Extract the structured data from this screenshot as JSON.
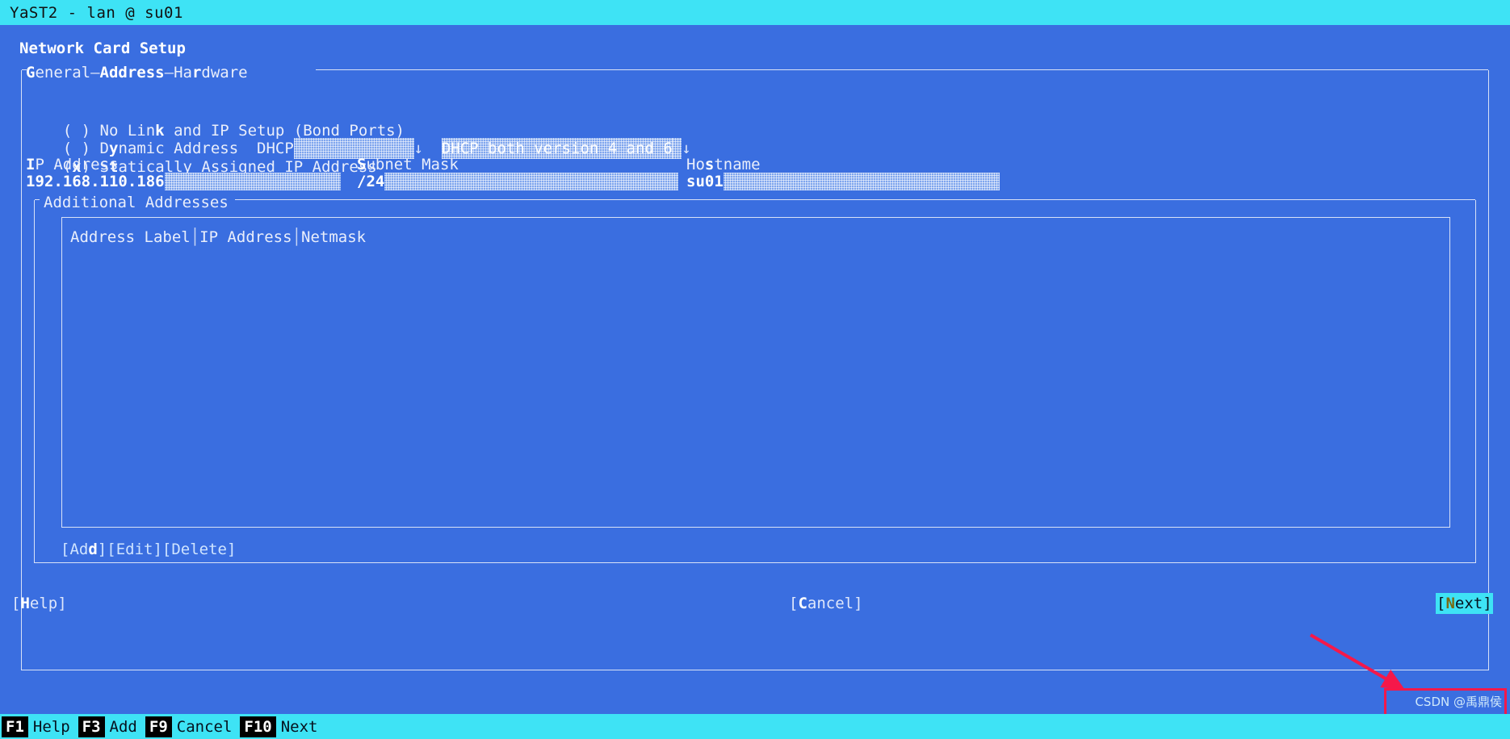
{
  "window": {
    "title": "YaST2 - lan @ su01"
  },
  "dialog": {
    "title": "Network Card Setup"
  },
  "tabs": [
    {
      "label": "General",
      "shortcut": "G",
      "active": false
    },
    {
      "label": "Address",
      "shortcut": "A",
      "active": true
    },
    {
      "label": "Hardware",
      "shortcut": "r",
      "active": false
    }
  ],
  "tab_separator": "—",
  "address_tab": {
    "radios": [
      {
        "marker": "( )",
        "label_pre": "No Lin",
        "shortcut": "k",
        "label_post": " and IP Setup (Bond Ports)",
        "selected": false
      },
      {
        "marker": "( )",
        "label_pre": "D",
        "shortcut": "y",
        "label_post": "namic Address",
        "selected": false
      },
      {
        "marker": "(x)",
        "label_pre": "S",
        "shortcut": "t",
        "label_post": "atically Assigned IP Address",
        "selected": true
      }
    ],
    "dhcp_combo": {
      "label": "DHCP",
      "value": "",
      "arrow": "↓"
    },
    "dhcp_version_combo": {
      "value": "DHCP both version 4 and 6",
      "arrow": "↓"
    },
    "fields": [
      {
        "name": "ip-address",
        "label_pre": "",
        "shortcut": "I",
        "label_post": "P Address",
        "value": "192.168.110.186"
      },
      {
        "name": "subnet-mask",
        "label_pre": "",
        "shortcut": "S",
        "label_post": "ubnet Mask",
        "value": "/24"
      },
      {
        "name": "hostname",
        "label_pre": "Ho",
        "shortcut": "s",
        "label_post": "tname",
        "value": "su01"
      }
    ],
    "additional_addresses": {
      "frame_label": "Additional Addresses",
      "columns": [
        "Address Label",
        "IP Address",
        "Netmask"
      ],
      "rows": [],
      "buttons": [
        {
          "label_pre": "Ad",
          "shortcut": "d",
          "label_post": ""
        },
        {
          "label_pre": "Edit",
          "shortcut": "",
          "label_post": ""
        },
        {
          "label_pre": "Delete",
          "shortcut": "",
          "label_post": ""
        }
      ]
    }
  },
  "footer_buttons": {
    "help": {
      "label_pre": "",
      "shortcut": "H",
      "label_post": "elp"
    },
    "cancel": {
      "label_pre": "",
      "shortcut": "C",
      "label_post": "ancel"
    },
    "next": {
      "label_pre": "",
      "shortcut": "N",
      "label_post": "ext",
      "focused": true
    }
  },
  "function_keys": [
    {
      "key": "F1",
      "label": "Help"
    },
    {
      "key": "F3",
      "label": "Add"
    },
    {
      "key": "F9",
      "label": "Cancel"
    },
    {
      "key": "F10",
      "label": "Next"
    }
  ],
  "annotation": {
    "color": "#f5184a",
    "target": "next-button"
  },
  "watermark": "CSDN @禹鼎侯",
  "colors": {
    "titlebar_bg": "#3ee3f5",
    "screen_bg": "#3a6ee0",
    "field_bg": "#7ea5ee",
    "text": "#e9eefb",
    "highlight": "#ffffff",
    "annotation": "#f5184a"
  }
}
